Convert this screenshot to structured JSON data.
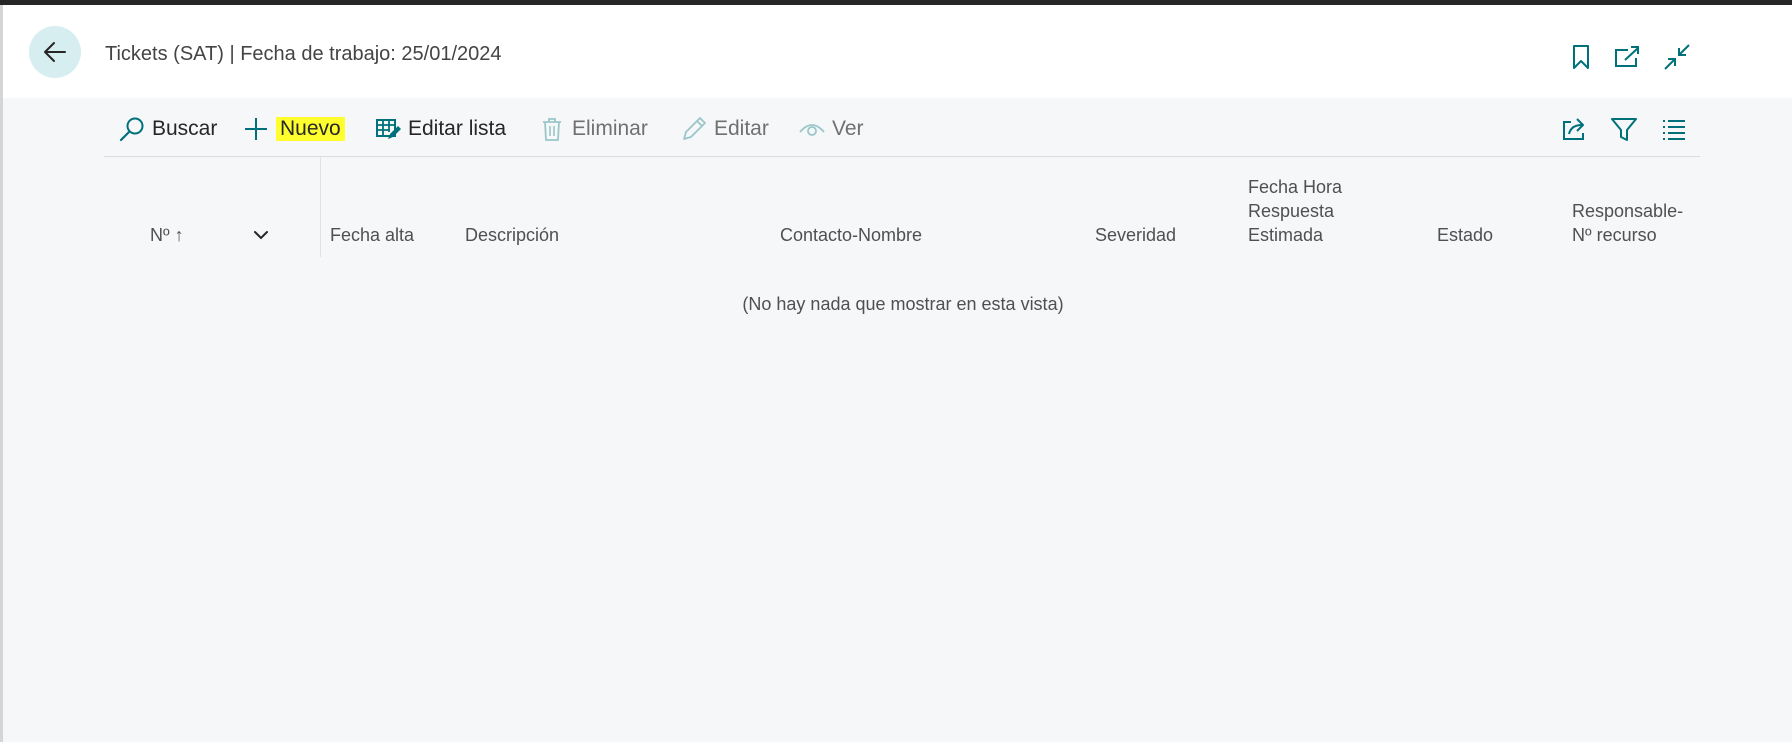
{
  "header": {
    "title": "Tickets (SAT) | Fecha de trabajo: 25/01/2024",
    "icons": [
      "arrow-left-icon",
      "bookmark-icon",
      "open-in-new-window-icon",
      "collapse-icon"
    ]
  },
  "toolbar": {
    "search_label": "Buscar",
    "new_label": "Nuevo",
    "edit_list_label": "Editar lista",
    "delete_label": "Eliminar",
    "edit_label": "Editar",
    "view_label": "Ver",
    "right_icons": [
      "share-icon",
      "filter-icon",
      "list-icon"
    ]
  },
  "table": {
    "columns": [
      "Nº ↑",
      "Fecha alta",
      "Descripción",
      "Contacto-Nombre",
      "Severidad",
      "Fecha Hora Respuesta Estimada",
      "Estado",
      "Responsable-Nº recurso"
    ],
    "column_lines": {
      "fecha_hora_1": "Fecha Hora",
      "fecha_hora_2": "Respuesta",
      "fecha_hora_3": "Estimada",
      "responsable_1": "Responsable-",
      "responsable_2": "Nº recurso"
    },
    "empty_message": "(No hay nada que mostrar en esta vista)"
  },
  "colors": {
    "accent": "#00707a",
    "highlight": "#ffff2e",
    "back_button_bg": "#d7eef1"
  }
}
